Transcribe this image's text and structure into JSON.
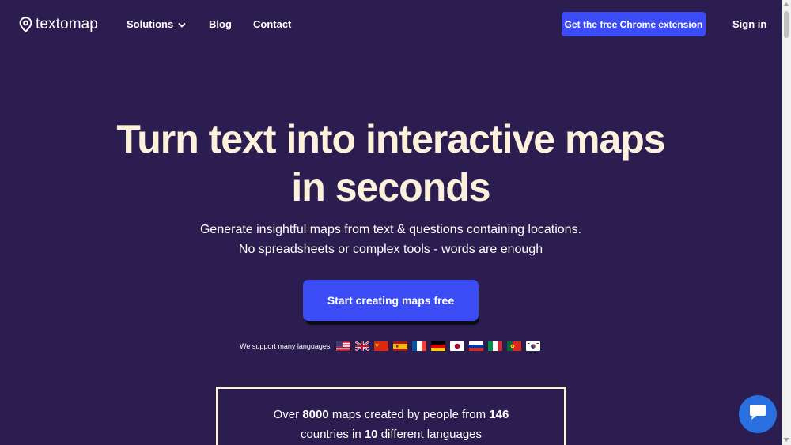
{
  "brand": {
    "name": "textomap"
  },
  "nav": {
    "solutions": "Solutions",
    "blog": "Blog",
    "contact": "Contact",
    "chrome_extension": "Get the free Chrome extension",
    "sign_in": "Sign in"
  },
  "hero": {
    "title_line1": "Turn text into interactive maps",
    "title_line2": "in seconds",
    "subtitle_line1": "Generate insightful maps from text & questions containing locations.",
    "subtitle_line2": "No spreadsheets or complex tools - words are enough",
    "cta": "Start creating maps free"
  },
  "languages": {
    "label": "We support many languages",
    "flags": [
      "us-flag",
      "uk-flag",
      "china-flag",
      "spain-flag",
      "france-flag",
      "germany-flag",
      "japan-flag",
      "russia-flag",
      "italy-flag",
      "portugal-flag",
      "korea-flag"
    ]
  },
  "stats": {
    "prefix": "Over",
    "maps_count": "8000",
    "middle": "maps created by people from",
    "countries_count": "146",
    "line2_prefix": "countries in",
    "languages_count": "10",
    "line2_suffix": "different languages"
  },
  "colors": {
    "background": "#2b1d4f",
    "accent": "#3b4cf5",
    "headline": "#fdf1dc",
    "chat": "#2a6fe0"
  },
  "icons": {
    "logo": "map-pin-icon",
    "dropdown": "chevron-down-icon",
    "chat": "chat-bubble-icon"
  }
}
